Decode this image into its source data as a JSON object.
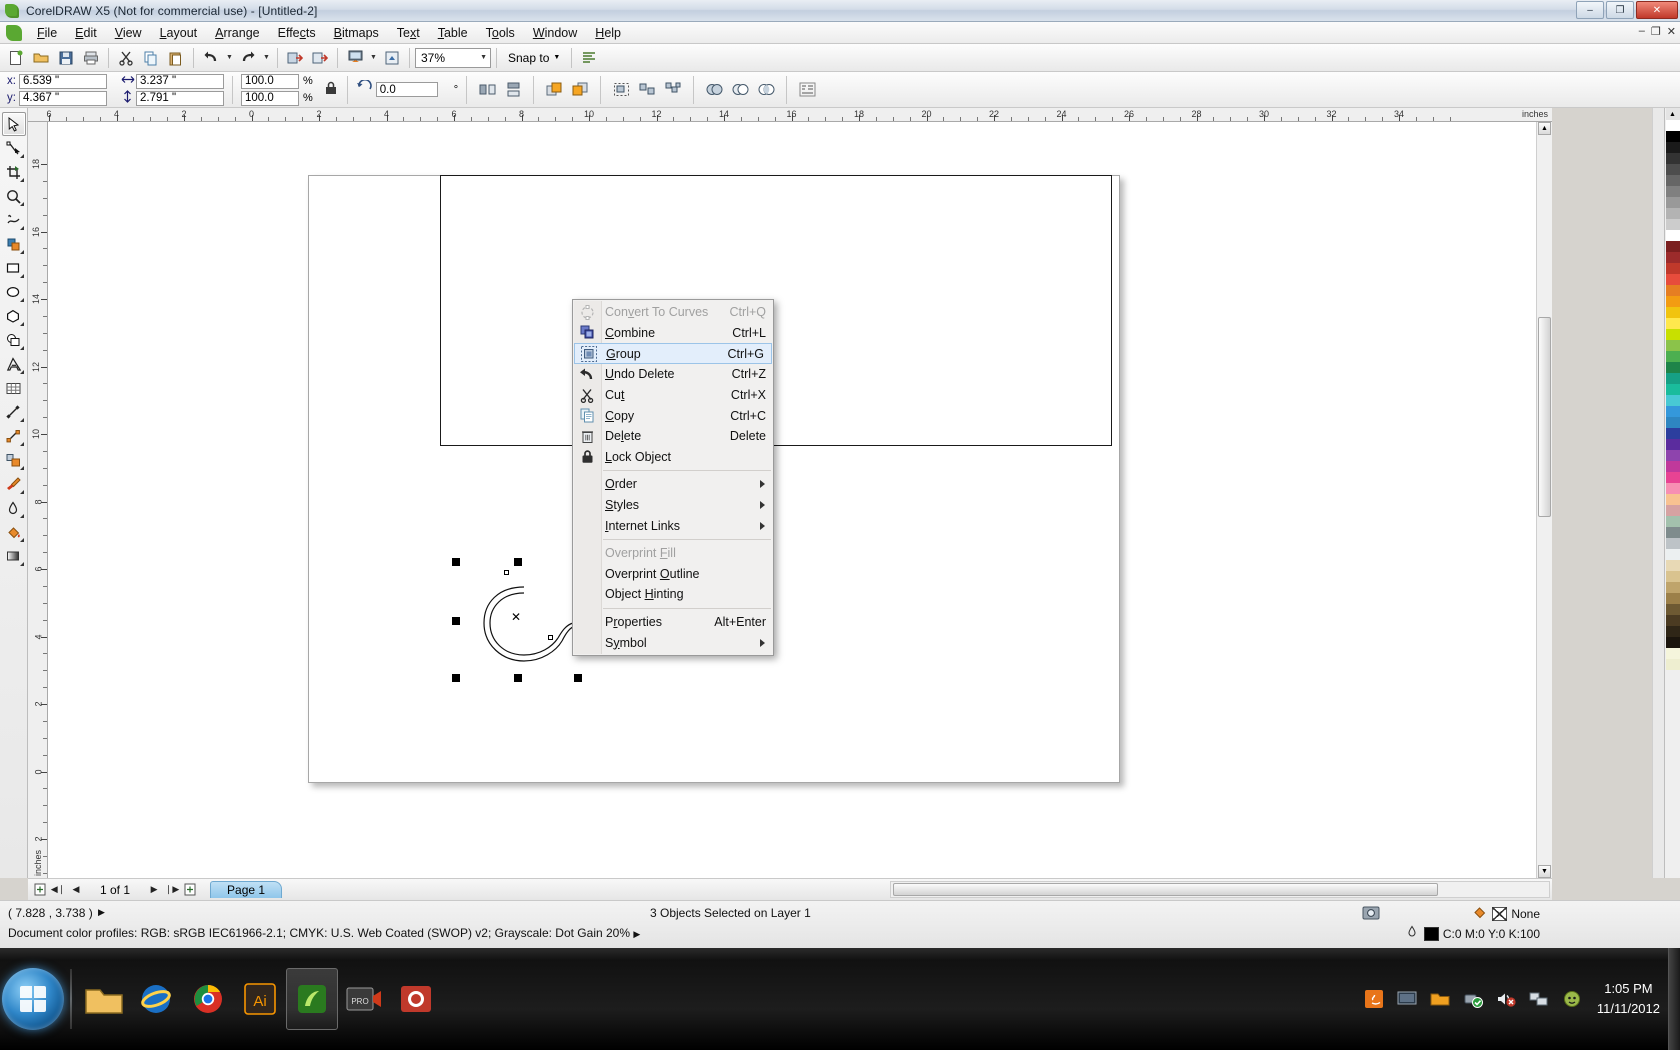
{
  "window": {
    "title": "CorelDRAW X5 (Not for commercial use) - [Untitled-2]",
    "minimize": "–",
    "maximize": "❐",
    "close": "✕"
  },
  "menubar": {
    "items": [
      {
        "label": "File"
      },
      {
        "label": "Edit"
      },
      {
        "label": "View"
      },
      {
        "label": "Layout"
      },
      {
        "label": "Arrange"
      },
      {
        "label": "Effects"
      },
      {
        "label": "Bitmaps"
      },
      {
        "label": "Text"
      },
      {
        "label": "Table"
      },
      {
        "label": "Tools"
      },
      {
        "label": "Window"
      },
      {
        "label": "Help"
      }
    ],
    "doc_minimize": "–",
    "doc_restore": "❐",
    "doc_close": "✕"
  },
  "toolbar": {
    "new_label": "new-document",
    "open_label": "open",
    "save_label": "save",
    "print_label": "print",
    "cut_label": "cut",
    "copy_label": "copy",
    "paste_label": "paste",
    "undo_label": "undo",
    "redo_label": "redo",
    "import_label": "import",
    "export_label": "export",
    "app_launcher_label": "application-launcher",
    "publish_pdf_label": "publish-to-pdf",
    "zoom_level": "37%",
    "snap_to_label": "Snap to",
    "options_label": "options"
  },
  "propertybar": {
    "x_label": "x:",
    "y_label": "y:",
    "x_value": "6.539 \"",
    "y_value": "4.367 \"",
    "width_value": "3.237 \"",
    "height_value": "2.791 \"",
    "scale_h": "100.0",
    "scale_v": "100.0",
    "percent_sign": "%",
    "lock_ratio_label": "lock-ratio",
    "angle_value": "0.0",
    "degree_sign": "°",
    "mirror_h_label": "mirror-horizontal",
    "mirror_v_label": "mirror-vertical",
    "to_front_label": "to-front",
    "to_back_label": "to-back",
    "group_label": "group",
    "ungroup_label": "ungroup",
    "ungroup_all_label": "ungroup-all",
    "weld_label": "weld",
    "trim_label": "trim",
    "intersect_label": "intersect",
    "simplify_label": "simplify",
    "wrap_text_label": "wrap-paragraph-text"
  },
  "rulers": {
    "unit": "inches",
    "h_labels": [
      "6",
      "4",
      "2",
      "0",
      "2",
      "4",
      "6",
      "8",
      "10",
      "12",
      "14",
      "16",
      "18",
      "20",
      "22",
      "24",
      "26",
      "28",
      "30",
      "32",
      "34"
    ],
    "v_labels": [
      "18",
      "16",
      "14",
      "12",
      "10",
      "8",
      "6",
      "4",
      "2",
      "0",
      "2"
    ]
  },
  "toolbox": {
    "tools": [
      {
        "name": "pick-tool",
        "selected": true
      },
      {
        "name": "shape-tool",
        "selected": false
      },
      {
        "name": "crop-tool",
        "selected": false
      },
      {
        "name": "zoom-tool",
        "selected": false
      },
      {
        "name": "freehand-tool",
        "selected": false
      },
      {
        "name": "smart-fill-tool",
        "selected": false
      },
      {
        "name": "rectangle-tool",
        "selected": false
      },
      {
        "name": "ellipse-tool",
        "selected": false
      },
      {
        "name": "polygon-tool",
        "selected": false
      },
      {
        "name": "basic-shapes-tool",
        "selected": false
      },
      {
        "name": "text-tool",
        "selected": false
      },
      {
        "name": "table-tool",
        "selected": false
      },
      {
        "name": "dimension-tool",
        "selected": false
      },
      {
        "name": "connector-tool",
        "selected": false
      },
      {
        "name": "blend-tool",
        "selected": false
      },
      {
        "name": "color-eyedropper-tool",
        "selected": false
      },
      {
        "name": "outline-tool",
        "selected": false
      },
      {
        "name": "fill-tool",
        "selected": false
      },
      {
        "name": "interactive-fill-tool",
        "selected": false
      }
    ]
  },
  "context_menu": {
    "groups": [
      [
        {
          "id": "convert-to-curves",
          "label_pre": "Con",
          "label_key": "v",
          "label_post": "ert To Curves",
          "shortcut": "Ctrl+Q",
          "disabled": true,
          "icon": "convert-to-curves-icon",
          "submenu": false
        },
        {
          "id": "combine",
          "label_pre": "",
          "label_key": "C",
          "label_post": "ombine",
          "shortcut": "Ctrl+L",
          "disabled": false,
          "icon": "combine-icon",
          "submenu": false
        },
        {
          "id": "group",
          "label_pre": "",
          "label_key": "G",
          "label_post": "roup",
          "shortcut": "Ctrl+G",
          "disabled": false,
          "icon": "group-icon",
          "submenu": false,
          "highlighted": true
        },
        {
          "id": "undo-delete",
          "label_pre": "",
          "label_key": "U",
          "label_post": "ndo Delete",
          "shortcut": "Ctrl+Z",
          "disabled": false,
          "icon": "undo-icon",
          "submenu": false
        },
        {
          "id": "cut",
          "label_pre": "Cu",
          "label_key": "t",
          "label_post": "",
          "shortcut": "Ctrl+X",
          "disabled": false,
          "icon": "scissors-icon",
          "submenu": false
        },
        {
          "id": "copy",
          "label_pre": "",
          "label_key": "C",
          "label_post": "opy",
          "shortcut": "Ctrl+C",
          "disabled": false,
          "icon": "copy-icon",
          "submenu": false
        },
        {
          "id": "delete",
          "label_pre": "De",
          "label_key": "l",
          "label_post": "ete",
          "shortcut": "Delete",
          "disabled": false,
          "icon": "trash-icon",
          "submenu": false
        },
        {
          "id": "lock-object",
          "label_pre": "",
          "label_key": "L",
          "label_post": "ock Object",
          "shortcut": "",
          "disabled": false,
          "icon": "lock-icon",
          "submenu": false
        }
      ],
      [
        {
          "id": "order",
          "label_pre": "",
          "label_key": "O",
          "label_post": "rder",
          "shortcut": "",
          "disabled": false,
          "icon": "",
          "submenu": true
        },
        {
          "id": "styles",
          "label_pre": "",
          "label_key": "S",
          "label_post": "tyles",
          "shortcut": "",
          "disabled": false,
          "icon": "",
          "submenu": true
        },
        {
          "id": "internet-links",
          "label_pre": "",
          "label_key": "I",
          "label_post": "nternet Links",
          "shortcut": "",
          "disabled": false,
          "icon": "",
          "submenu": true
        }
      ],
      [
        {
          "id": "overprint-fill",
          "label_pre": "Overprint ",
          "label_key": "F",
          "label_post": "ill",
          "shortcut": "",
          "disabled": true,
          "icon": "",
          "submenu": false
        },
        {
          "id": "overprint-outline",
          "label_pre": "Overprint ",
          "label_key": "O",
          "label_post": "utline",
          "shortcut": "",
          "disabled": false,
          "icon": "",
          "submenu": false
        },
        {
          "id": "object-hinting",
          "label_pre": "Object ",
          "label_key": "H",
          "label_post": "inting",
          "shortcut": "",
          "disabled": false,
          "icon": "",
          "submenu": false
        }
      ],
      [
        {
          "id": "properties",
          "label_pre": "P",
          "label_key": "r",
          "label_post": "operties",
          "shortcut": "Alt+Enter",
          "disabled": false,
          "icon": "",
          "submenu": false
        },
        {
          "id": "symbol",
          "label_pre": "S",
          "label_key": "y",
          "label_post": "mbol",
          "shortcut": "",
          "disabled": false,
          "icon": "",
          "submenu": true
        }
      ]
    ]
  },
  "navbar": {
    "add_page_start_label": "add-page-before",
    "first_label": "◀❘",
    "prev_label": "◀",
    "page_count": "1 of 1",
    "next_label": "▶",
    "last_label": "❘▶",
    "add_page_end_label": "add-page-after",
    "page_tab": "Page 1"
  },
  "statusbar": {
    "coords": "( 7.828 , 3.738 )",
    "coords_arrow": "▶",
    "selection": "3 Objects Selected on Layer 1",
    "color_profiles": "Document color profiles: RGB: sRGB IEC61966-2.1; CMYK: U.S. Web Coated (SWOP) v2; Grayscale: Dot Gain 20%",
    "profiles_arrow": "▶",
    "fill_value": "None",
    "outline_value": "C:0 M:0 Y:0 K:100",
    "snapshot_label": "snapshot-icon"
  },
  "taskbar": {
    "items": [
      {
        "name": "windows-explorer",
        "label": "explorer-icon"
      },
      {
        "name": "internet-explorer",
        "label": "ie-icon"
      },
      {
        "name": "google-chrome",
        "label": "chrome-icon"
      },
      {
        "name": "adobe-illustrator",
        "label": "Ai"
      },
      {
        "name": "corel-draw",
        "label": "coreldraw-icon"
      },
      {
        "name": "video-app",
        "label": "video-icon"
      },
      {
        "name": "screen-recorder",
        "label": "recorder-icon"
      }
    ],
    "tray": [
      "java-icon",
      "display-icon",
      "folder-icon",
      "safely-remove-icon",
      "volume-muted-icon",
      "network-icon",
      "messenger-icon"
    ],
    "time": "1:05 PM",
    "date": "11/11/2012"
  },
  "palette": {
    "colors": [
      "#ffffff",
      "#000000",
      "#1a1a1a",
      "#333333",
      "#4d4d4d",
      "#666666",
      "#808080",
      "#999999",
      "#b3b3b3",
      "#cccccc",
      "#ffffff",
      "#7b1f1f",
      "#9c2b2b",
      "#c0392b",
      "#e74c3c",
      "#e67e22",
      "#f39c12",
      "#f1c40f",
      "#ffe84d",
      "#c8e000",
      "#8bc34a",
      "#4caf50",
      "#1e8449",
      "#16a085",
      "#1abc9c",
      "#48c9d4",
      "#3498db",
      "#2e86c1",
      "#2c3e9e",
      "#5b2c9e",
      "#8e44ad",
      "#c0399b",
      "#e84393",
      "#f78fb3",
      "#f8c291",
      "#d6a2a2",
      "#a3c1ad",
      "#7f8c8d",
      "#bdc3c7",
      "#ecf0f1",
      "#e8d9b5",
      "#d9c38f",
      "#bfa46b",
      "#9c8049",
      "#6e5a33",
      "#4b3b22",
      "#2f2617",
      "#1b150d",
      "#f5f5dc",
      "#eeeed0"
    ]
  }
}
